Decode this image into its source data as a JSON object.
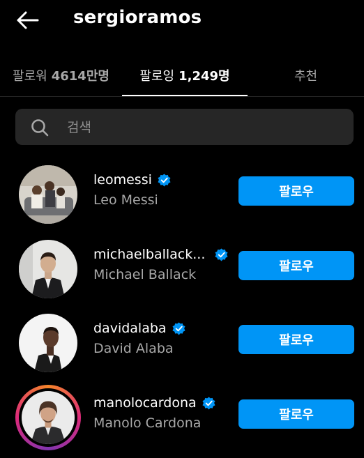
{
  "header": {
    "title": "sergioramos",
    "back_icon": "arrow-left-icon"
  },
  "tabs": [
    {
      "label": "팔로워",
      "count": "4614만명",
      "active": false
    },
    {
      "label": "팔로잉",
      "count": "1,249명",
      "active": true
    },
    {
      "label": "추천",
      "count": "",
      "active": false
    }
  ],
  "search": {
    "placeholder": "검색",
    "value": ""
  },
  "colors": {
    "accent": "#0095f6",
    "background": "#000000",
    "muted": "#a8a8a8",
    "search_bg": "#262626"
  },
  "users": [
    {
      "username": "leomessi",
      "fullname": "Leo Messi",
      "verified": true,
      "button": "팔로우",
      "story": false
    },
    {
      "username": "michaelballack...",
      "fullname": "Michael Ballack",
      "verified": true,
      "button": "팔로우",
      "story": false
    },
    {
      "username": "davidalaba",
      "fullname": "David Alaba",
      "verified": true,
      "button": "팔로우",
      "story": false
    },
    {
      "username": "manolocardona",
      "fullname": "Manolo Cardona",
      "verified": true,
      "button": "팔로우",
      "story": true
    }
  ]
}
